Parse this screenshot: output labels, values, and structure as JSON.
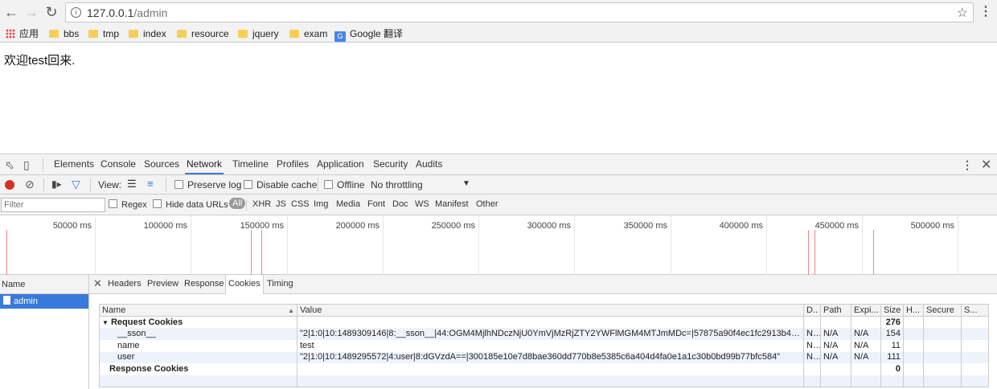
{
  "browser": {
    "url_host": "127.0.0.1",
    "url_path": "/admin",
    "bookmarks": [
      "应用",
      "bbs",
      "tmp",
      "index",
      "resource",
      "jquery",
      "exam",
      "Google 翻译"
    ]
  },
  "page": {
    "text": "欢迎test回来."
  },
  "devtools": {
    "tabs": [
      "Elements",
      "Console",
      "Sources",
      "Network",
      "Timeline",
      "Profiles",
      "Application",
      "Security",
      "Audits"
    ],
    "active_tab": "Network",
    "toolbar": {
      "view_label": "View:",
      "preserve_log": "Preserve log",
      "disable_cache": "Disable cache",
      "offline": "Offline",
      "throttling": "No throttling"
    },
    "filter": {
      "placeholder": "Filter",
      "regex": "Regex",
      "hide_data_urls": "Hide data URLs",
      "types": [
        "All",
        "XHR",
        "JS",
        "CSS",
        "Img",
        "Media",
        "Font",
        "Doc",
        "WS",
        "Manifest",
        "Other"
      ]
    },
    "timeline_labels": [
      "50000 ms",
      "100000 ms",
      "150000 ms",
      "200000 ms",
      "250000 ms",
      "300000 ms",
      "350000 ms",
      "400000 ms",
      "450000 ms",
      "500000 ms"
    ],
    "timeline_marks_ms": [
      300,
      128000,
      133500,
      418500,
      422000,
      452500
    ],
    "name_header": "Name",
    "requests": [
      "admin"
    ],
    "detail_tabs": [
      "Headers",
      "Preview",
      "Response",
      "Cookies",
      "Timing"
    ],
    "active_detail_tab": "Cookies",
    "cookies": {
      "columns": [
        "Name",
        "Value",
        "D..",
        "Path",
        "Expi...",
        "Size",
        "H...",
        "Secure",
        "S..."
      ],
      "request_group": "Request Cookies",
      "request_total": "276",
      "rows": [
        {
          "name": "__sson__",
          "value": "\"2|1:0|10:1489309146|8:__sson__|44:OGM4MjlhNDczNjU0YmVjMzRjZTY2YWFlMGM4MTJmMDc=|57875a90f4ec1fc2913b4a1d64...",
          "domain": "N...",
          "path": "N/A",
          "expires": "N/A",
          "size": "154"
        },
        {
          "name": "name",
          "value": "test",
          "domain": "N...",
          "path": "N/A",
          "expires": "N/A",
          "size": "11"
        },
        {
          "name": "user",
          "value": "\"2|1:0|10:1489295572|4:user|8:dGVzdA==|300185e10e7d8bae360dd770b8e5385c6a404d4fa0e1a1c30b0bd99b77bfc584\"",
          "domain": "N...",
          "path": "N/A",
          "expires": "N/A",
          "size": "111"
        }
      ],
      "response_group": "Response Cookies",
      "response_total": "0"
    }
  }
}
